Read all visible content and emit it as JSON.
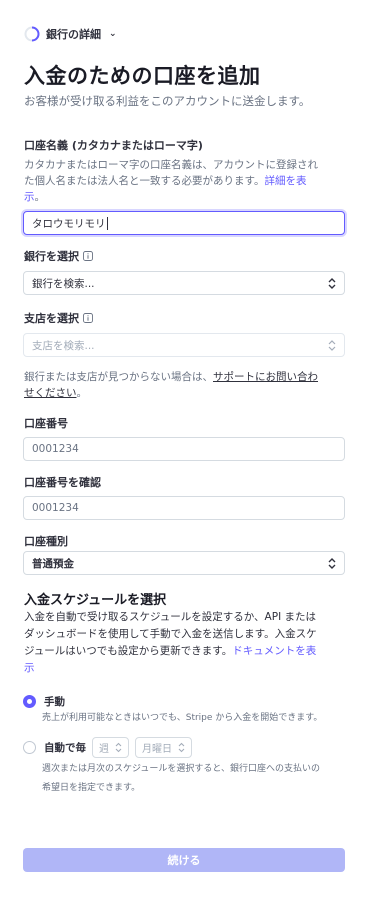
{
  "header": {
    "step_label": "銀行の詳細",
    "title": "入金のための口座を追加",
    "subtitle": "お客様が受け取る利益をこのアカウントに送金します。"
  },
  "account_name": {
    "label": "口座名義 (カタカナまたはローマ字)",
    "help_line1": "カタカナまたはローマ字の口座名義は、アカウントに登録され",
    "help_line2_prefix": "た個人名または法人名と一致する必要があります。",
    "help_link_a": "詳細を表",
    "help_link_b": "示",
    "help_suffix": "。",
    "value": "タロウモリモリ"
  },
  "bank": {
    "label": "銀行を選択",
    "placeholder": "銀行を検索..."
  },
  "branch": {
    "label": "支店を選択",
    "placeholder": "支店を検索..."
  },
  "not_found": {
    "prefix": "銀行または支店が見つからない場合は、",
    "link_a": "サポートにお問い合わ",
    "link_b": "せください",
    "suffix": "。"
  },
  "account_number": {
    "label": "口座番号",
    "placeholder": "0001234"
  },
  "confirm_number": {
    "label": "口座番号を確認",
    "placeholder": "0001234"
  },
  "account_type": {
    "label": "口座種別",
    "value": "普通預金"
  },
  "schedule": {
    "title": "入金スケジュールを選択",
    "desc_line1": "入金を自動で受け取るスケジュールを設定するか、API または",
    "desc_line2": "ダッシュボードを使用して手動で入金を送信します。入金スケ",
    "desc_line3_prefix": "ジュールはいつでも設定から更新できます。",
    "doc_link_a": "ドキュメントを表",
    "doc_link_b": "示",
    "manual_label": "手動",
    "manual_desc": "売上が利用可能なときはいつでも、Stripe から入金を開始できます。",
    "auto_label": "自動で毎",
    "interval_value": "週",
    "day_value": "月曜日",
    "auto_desc_line1": "週次または月次のスケジュールを選択すると、銀行口座への支払いの",
    "auto_desc_line2": "希望日を指定できます。"
  },
  "continue_label": "続ける",
  "colors": {
    "accent": "#635bff",
    "button_disabled": "#b0b6f7",
    "text": "#30313d",
    "muted": "#6a7383"
  },
  "icons": {
    "step": "spinner-ring-icon",
    "info": "info-icon",
    "select": "chevron-up-down-icon"
  }
}
